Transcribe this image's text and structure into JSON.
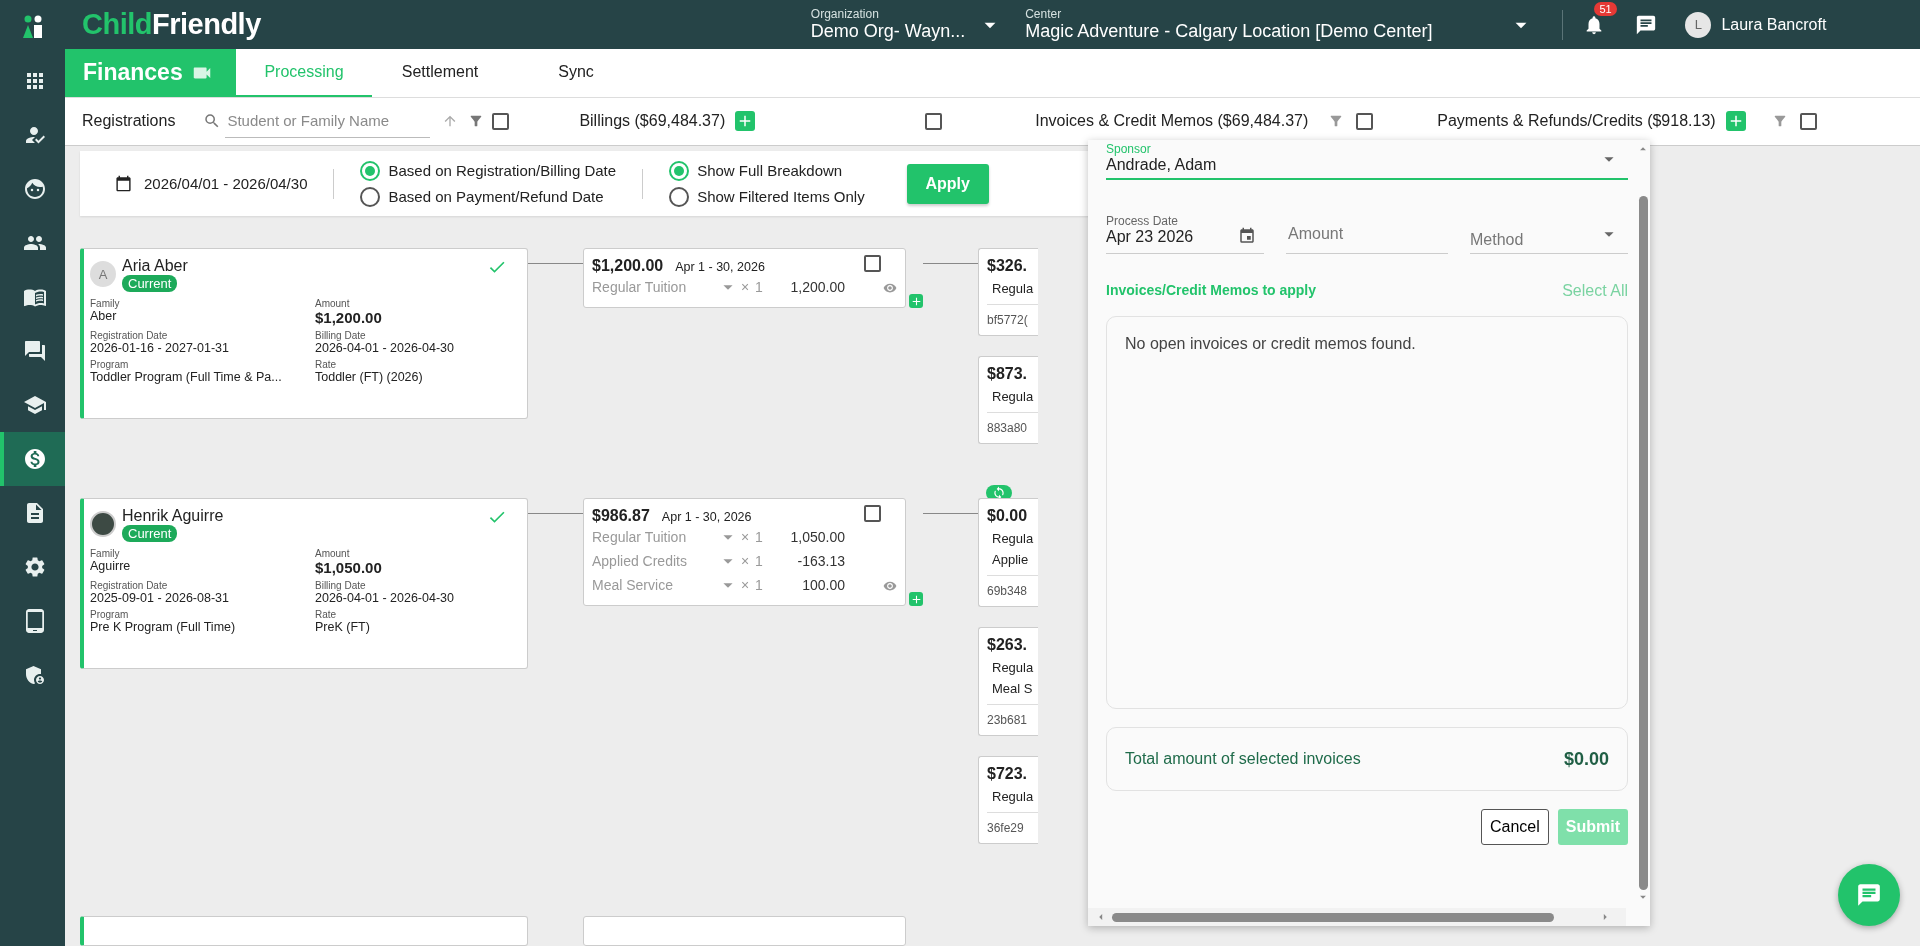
{
  "logo": {
    "lead": "Child",
    "rest": "Friendly"
  },
  "header": {
    "organization": {
      "label": "Organization",
      "value": "Demo Org- Wayn..."
    },
    "center": {
      "label": "Center",
      "value": "Magic Adventure - Calgary Location [Demo Center]"
    },
    "notifications": "51",
    "user": {
      "initial": "L",
      "name": "Laura Bancroft"
    }
  },
  "sidebar": {
    "items": [
      {
        "selected": false
      },
      {
        "selected": false
      },
      {
        "selected": false
      },
      {
        "selected": false
      },
      {
        "selected": false
      },
      {
        "selected": false
      },
      {
        "selected": false
      },
      {
        "selected": true
      },
      {
        "selected": false
      },
      {
        "selected": false
      },
      {
        "selected": false
      },
      {
        "selected": false
      }
    ]
  },
  "module": {
    "title": "Finances"
  },
  "tabs": [
    {
      "label": "Processing",
      "selected": true
    },
    {
      "label": "Settlement",
      "selected": false
    },
    {
      "label": "Sync",
      "selected": false
    }
  ],
  "columns": {
    "registrations": {
      "title": "Registrations",
      "search_placeholder": "Student or Family Name",
      "checked": false
    },
    "billings": {
      "title": "Billings ($69,484.37)",
      "checked": false
    },
    "invoices": {
      "title": "Invoices & Credit Memos ($69,484.37)",
      "checked": false
    },
    "payments": {
      "title": "Payments & Refunds/Credits ($918.13)",
      "checked": false
    }
  },
  "filters": {
    "date_range": "2026/04/01 - 2026/04/30",
    "date_basis": [
      {
        "label": "Based on Registration/Billing Date",
        "selected": true
      },
      {
        "label": "Based on Payment/Refund Date",
        "selected": false
      }
    ],
    "breakdown": [
      {
        "label": "Show Full Breakdown",
        "selected": true
      },
      {
        "label": "Show Filtered Items Only",
        "selected": false
      }
    ],
    "apply": "Apply"
  },
  "rows": [
    {
      "registration": {
        "name": "Aria Aber",
        "avatar": "A",
        "status": "Current",
        "fields": [
          {
            "label": "Family",
            "value": "Aber"
          },
          {
            "label": "Amount",
            "value": "$1,200.00"
          },
          {
            "label": "Registration Date",
            "value": "2026-01-16 - 2027-01-31"
          },
          {
            "label": "Billing Date",
            "value": "2026-04-01 - 2026-04-30"
          },
          {
            "label": "Program",
            "value": "Toddler Program (Full Time & Pa..."
          },
          {
            "label": "Rate",
            "value": "Toddler (FT) (2026)"
          }
        ]
      },
      "billing": {
        "total": "$1,200.00",
        "period": "Apr 1 - 30, 2026",
        "checked": false,
        "lines": [
          {
            "name": "Regular Tuition",
            "times": "×",
            "qty": "1",
            "amount": "1,200.00"
          }
        ]
      },
      "invoices": [
        {
          "amount": "$326.",
          "lines": [
            "Regula"
          ],
          "ref": "bf5772(",
          "synced": false
        },
        {
          "amount": "$873.",
          "lines": [
            "Regula"
          ],
          "ref": "883a80",
          "synced": false
        }
      ]
    },
    {
      "registration": {
        "name": "Henrik Aguirre",
        "status": "Current",
        "fields": [
          {
            "label": "Family",
            "value": "Aguirre"
          },
          {
            "label": "Amount",
            "value": "$1,050.00"
          },
          {
            "label": "Registration Date",
            "value": "2025-09-01 - 2026-08-31"
          },
          {
            "label": "Billing Date",
            "value": "2026-04-01 - 2026-04-30"
          },
          {
            "label": "Program",
            "value": "Pre K Program (Full Time)"
          },
          {
            "label": "Rate",
            "value": "PreK (FT)"
          }
        ]
      },
      "billing": {
        "total": "$986.87",
        "period": "Apr 1 - 30, 2026",
        "checked": false,
        "lines": [
          {
            "name": "Regular Tuition",
            "times": "×",
            "qty": "1",
            "amount": "1,050.00"
          },
          {
            "name": "Applied Credits",
            "times": "×",
            "qty": "1",
            "amount": "-163.13"
          },
          {
            "name": "Meal Service",
            "times": "×",
            "qty": "1",
            "amount": "100.00"
          }
        ]
      },
      "invoices": [
        {
          "amount": "$0.00",
          "lines": [
            "Regula",
            "Applie"
          ],
          "ref": "69b348",
          "synced": true
        },
        {
          "amount": "$263.",
          "lines": [
            "Regula",
            "Meal S"
          ],
          "ref": "23b681",
          "synced": false
        },
        {
          "amount": "$723.",
          "lines": [
            "Regula"
          ],
          "ref": "36fe29",
          "synced": false
        }
      ]
    }
  ],
  "payment_form": {
    "sponsor": {
      "label": "Sponsor",
      "value": "Andrade, Adam"
    },
    "process_date": {
      "label": "Process Date",
      "value": "Apr 23 2026"
    },
    "amount": {
      "placeholder": "Amount"
    },
    "method": {
      "placeholder": "Method"
    },
    "apply_title": "Invoices/Credit Memos to apply",
    "select_all": "Select All",
    "empty_message": "No open invoices or credit memos found.",
    "total": {
      "label": "Total amount of selected invoices",
      "value": "$0.00"
    },
    "cancel": "Cancel",
    "submit": {
      "label": "Submit",
      "disabled": true
    }
  }
}
